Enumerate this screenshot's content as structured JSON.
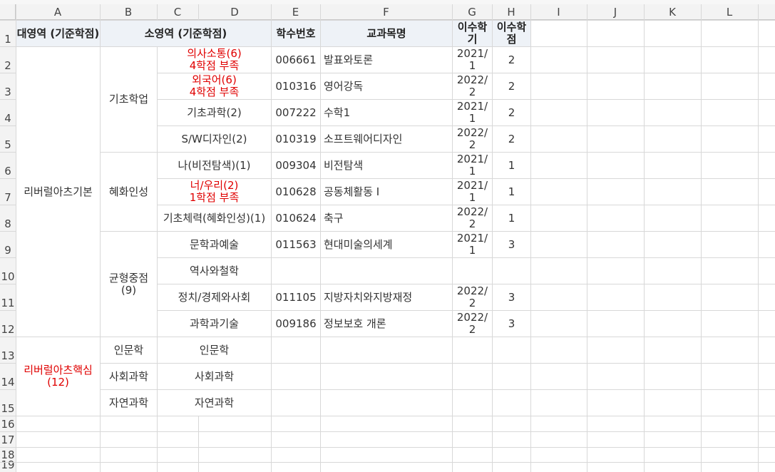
{
  "columns": [
    "A",
    "B",
    "C",
    "D",
    "E",
    "F",
    "G",
    "H",
    "I",
    "J",
    "K",
    "L"
  ],
  "rows": [
    "1",
    "2",
    "3",
    "4",
    "5",
    "6",
    "7",
    "8",
    "9",
    "10",
    "11",
    "12",
    "13",
    "14",
    "15",
    "16",
    "17",
    "18",
    "19"
  ],
  "header": {
    "major": "대영역 (기준학점)",
    "minor": "소영역 (기준학점)",
    "course_code": "학수번호",
    "course_name": "교과목명",
    "semester": "이수학기",
    "credits": "이수학점"
  },
  "groups": {
    "liberal_basic": "리버럴아츠기본",
    "liberal_core": "리버럴아츠핵심\n(12)",
    "basic_studies": "기초학업",
    "hyehwa": "혜화인성",
    "balanced": "균형중점\n(9)",
    "humanities": "인문학",
    "social": "사회과학",
    "natural": "자연과학"
  },
  "sub_areas": {
    "humanities_d": "인문학",
    "social_d": "사회과학",
    "natural_d": "자연과학"
  },
  "records": [
    {
      "area": "의사소통(6)\n4학점 부족",
      "code": "006661",
      "name": "발표와토론",
      "semester": "2021/\n1",
      "credits": "2"
    },
    {
      "area": "외국어(6)\n4학점 부족",
      "code": "010316",
      "name": "영어강독",
      "semester": "2022/\n2",
      "credits": "2"
    },
    {
      "area": "기초과학(2)",
      "code": "007222",
      "name": "수학1",
      "semester": "2021/\n1",
      "credits": "2"
    },
    {
      "area": "S/W디자인(2)",
      "code": "010319",
      "name": "소프트웨어디자인",
      "semester": "2022/\n2",
      "credits": "2"
    },
    {
      "area": "나(비전탐색)(1)",
      "code": "009304",
      "name": "비전탐색",
      "semester": "2021/\n1",
      "credits": "1"
    },
    {
      "area": "너/우리(2)\n1학점 부족",
      "code": "010628",
      "name": "공동체활동 I",
      "semester": "2021/\n1",
      "credits": "1"
    },
    {
      "area": "기초체력(혜화인성)(1)",
      "code": "010624",
      "name": "축구",
      "semester": "2022/\n2",
      "credits": "1"
    },
    {
      "area": "문학과예술",
      "code": "011563",
      "name": "현대미술의세계",
      "semester": "2021/\n1",
      "credits": "3"
    },
    {
      "area": "역사와철학",
      "code": "",
      "name": "",
      "semester": "",
      "credits": ""
    },
    {
      "area": "정치/경제와사회",
      "code": "011105",
      "name": "지방자치와지방재정",
      "semester": "2022/\n2",
      "credits": "3"
    },
    {
      "area": "과학과기술",
      "code": "009186",
      "name": "정보보호 개론",
      "semester": "2022/\n2",
      "credits": "3"
    }
  ]
}
